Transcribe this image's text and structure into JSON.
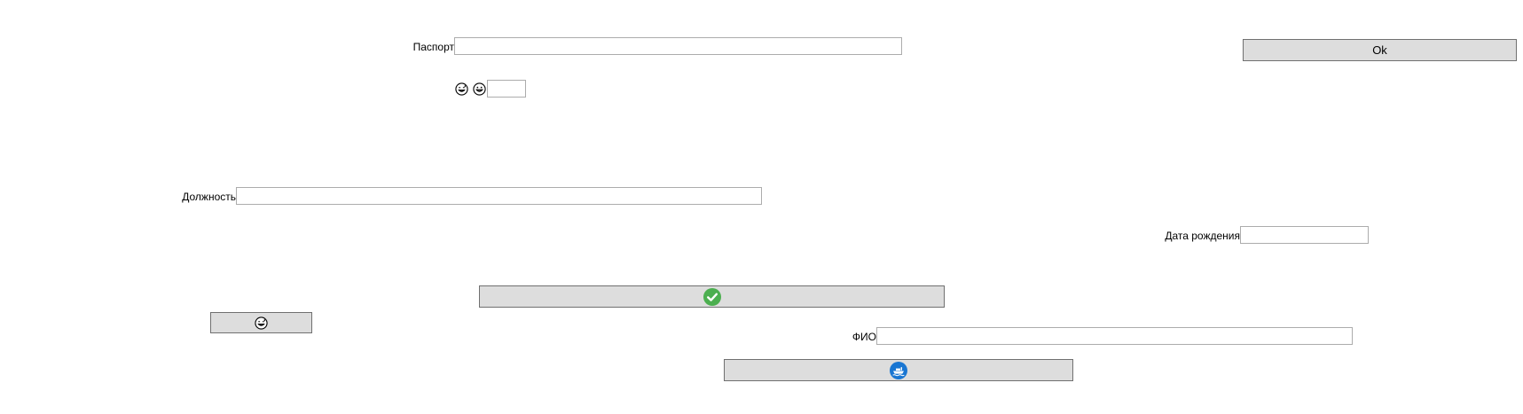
{
  "passport": {
    "label": "Паспорт",
    "value": ""
  },
  "ok_button": {
    "label": "Ok"
  },
  "emoji_field": {
    "value": "",
    "icons": [
      "grinning-sweat-face-icon",
      "grinning-face-icon"
    ]
  },
  "position": {
    "label": "Должность",
    "value": ""
  },
  "birth_date": {
    "label": "Дата рождения",
    "value": ""
  },
  "confirm_button": {
    "icon": "green-checkmark-icon",
    "icon_color": "#4caf50"
  },
  "emoji_button": {
    "icon": "grinning-sweat-face-icon"
  },
  "fio": {
    "label": "ФИО",
    "value": ""
  },
  "ship_button": {
    "icon": "blue-ship-icon",
    "icon_color": "#1976d2"
  }
}
